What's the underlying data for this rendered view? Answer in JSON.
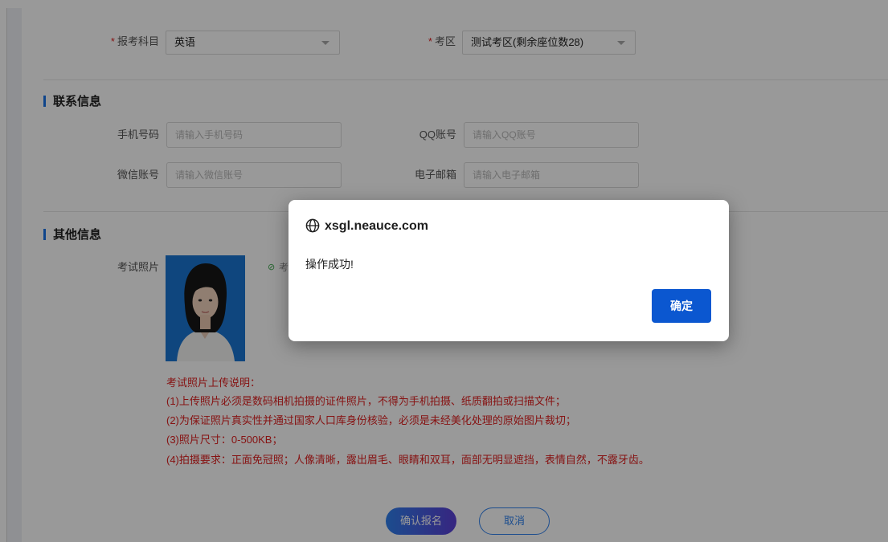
{
  "form": {
    "subject": {
      "label": "报考科目",
      "value": "英语"
    },
    "area": {
      "label": "考区",
      "value": "测试考区(剩余座位数28)"
    },
    "contact": {
      "title": "联系信息",
      "phone": {
        "label": "手机号码",
        "placeholder": "请输入手机号码"
      },
      "qq": {
        "label": "QQ账号",
        "placeholder": "请输入QQ账号"
      },
      "wechat": {
        "label": "微信账号",
        "placeholder": "请输入微信账号"
      },
      "email": {
        "label": "电子邮箱",
        "placeholder": "请输入电子邮箱"
      }
    },
    "other": {
      "title": "其他信息",
      "photo_label": "考试照片",
      "photo_status_text": "考"
    },
    "notes": [
      "考试照片上传说明：",
      "(1)上传照片必须是数码相机拍摄的证件照片，不得为手机拍摄、纸质翻拍或扫描文件；",
      "(2)为保证照片真实性并通过国家人口库身份核验，必须是未经美化处理的原始图片裁切；",
      "(3)照片尺寸：0-500KB；",
      "(4)拍摄要求：正面免冠照；人像清晰，露出眉毛、眼睛和双耳，面部无明显遮挡，表情自然，不露牙齿。"
    ],
    "buttons": {
      "confirm": "确认报名",
      "cancel": "取消"
    }
  },
  "dialog": {
    "site": "xsgl.neauce.com",
    "message": "操作成功!",
    "ok": "确定"
  },
  "colors": {
    "accent": "#1a73e8",
    "required": "#e02020",
    "dialog_button": "#0b57d0"
  }
}
